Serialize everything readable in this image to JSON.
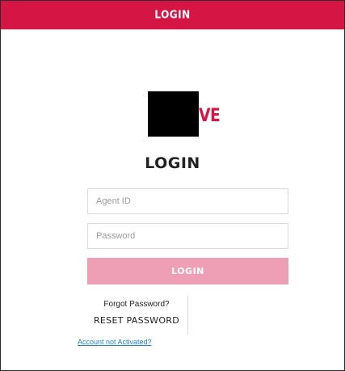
{
  "header": {
    "title": "LOGIN"
  },
  "logo": {
    "visible_text": "VE",
    "color": "#d51645"
  },
  "form": {
    "title": "LOGIN",
    "agent_id": {
      "value": "",
      "placeholder": "Agent ID"
    },
    "password": {
      "value": "",
      "placeholder": "Password"
    },
    "login_button": "LOGIN"
  },
  "links": {
    "forgot_label": "Forgot Password?",
    "reset_password": "RESET PASSWORD",
    "account_not_activated": "Account not Activated?"
  },
  "colors": {
    "brand": "#d51645",
    "button_disabled": "#ee9fb6",
    "link": "#1f86c8"
  }
}
